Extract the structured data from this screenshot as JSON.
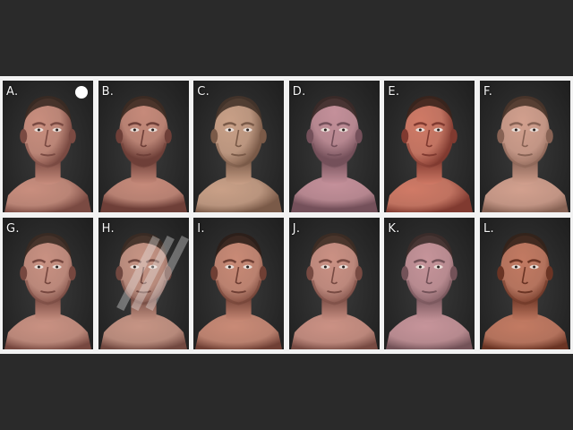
{
  "title": "",
  "panels": [
    {
      "label": "A.",
      "skin": "#c98e7e",
      "shade": "#7a4a42",
      "hair": "#3a2a22",
      "light": "left",
      "marker": true
    },
    {
      "label": "B.",
      "skin": "#c68a7a",
      "shade": "#6e3f38",
      "hair": "#3d2b22",
      "light": "top"
    },
    {
      "label": "C.",
      "skin": "#c9a087",
      "shade": "#7a5a48",
      "hair": "#45342a",
      "light": "left"
    },
    {
      "label": "D.",
      "skin": "#c4909a",
      "shade": "#74505a",
      "hair": "#3b2a28",
      "light": "top"
    },
    {
      "label": "E.",
      "skin": "#d07a66",
      "shade": "#803a30",
      "hair": "#3a241c",
      "light": "left"
    },
    {
      "label": "F.",
      "skin": "#d2a08e",
      "shade": "#876254",
      "hair": "#4a352a",
      "light": "front"
    },
    {
      "label": "G.",
      "skin": "#c99182",
      "shade": "#76473f",
      "hair": "#3a2a22",
      "light": "front"
    },
    {
      "label": "H.",
      "skin": "#c69484",
      "shade": "#714840",
      "hair": "#3b2b24",
      "light": "front",
      "stripes": true
    },
    {
      "label": "I.",
      "skin": "#c98a76",
      "shade": "#6f3f34",
      "hair": "#2c1e18",
      "light": "front"
    },
    {
      "label": "J.",
      "skin": "#cb9184",
      "shade": "#774a42",
      "hair": "#3d2c24",
      "light": "front"
    },
    {
      "label": "K.",
      "skin": "#c6949a",
      "shade": "#735258",
      "hair": "#3c2c2a",
      "light": "front"
    },
    {
      "label": "L.",
      "skin": "#c27a62",
      "shade": "#6a3424",
      "hair": "#34221a",
      "light": "front"
    }
  ]
}
